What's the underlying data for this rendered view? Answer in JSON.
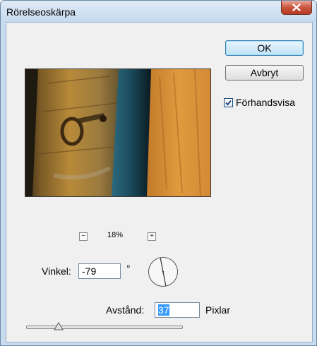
{
  "window": {
    "title": "Rörelseoskärpa"
  },
  "buttons": {
    "ok": "OK",
    "cancel": "Avbryt"
  },
  "preview_option": {
    "label": "Förhandsvisa",
    "checked": true
  },
  "zoom": {
    "level": "18%",
    "minus": "−",
    "plus": "+"
  },
  "angle": {
    "label": "Vinkel:",
    "value": "-79",
    "unit": "°"
  },
  "distance": {
    "label": "Avstånd:",
    "value": "37",
    "unit": "Pixlar"
  },
  "slider": {
    "value_fraction": 0.21
  },
  "icons": {
    "close": "close-icon",
    "checkmark": "checkmark-icon"
  }
}
